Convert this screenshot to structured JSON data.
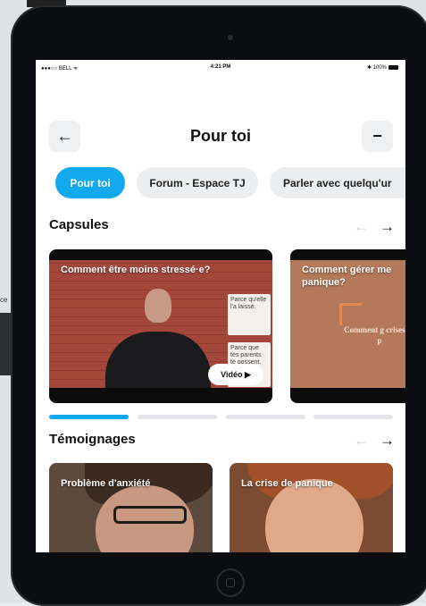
{
  "background": {
    "side_label": "ce"
  },
  "status_bar": {
    "carrier": "●●●○○ BELL ᯤ",
    "time": "4:21 PM",
    "battery": "✱ 100%"
  },
  "header": {
    "title": "Pour toi",
    "back_icon": "←",
    "minus_icon": "−"
  },
  "tabs": [
    {
      "label": "Pour toi",
      "active": true
    },
    {
      "label": "Forum - Espace TJ",
      "active": false
    },
    {
      "label": "Parler avec quelqu'ur",
      "active": false
    }
  ],
  "capsules": {
    "title": "Capsules",
    "prev_icon": "←",
    "next_icon": "→",
    "cards": [
      {
        "title": "Comment être moins stressé·e?",
        "button": "Vidéo ▶",
        "poster_top": "Parce qu'elle l'a laissé.",
        "poster_bottom": "Parce que tes parents te gossent."
      },
      {
        "title": "Comment gérer me panique?",
        "overlay": "Comment g crises de p"
      }
    ],
    "progress": {
      "active_index": 0,
      "count": 4
    }
  },
  "temoignages": {
    "title": "Témoignages",
    "prev_icon": "←",
    "next_icon": "→",
    "cards": [
      {
        "title": "Problème d'anxiété"
      },
      {
        "title": "La crise de panique"
      }
    ]
  },
  "colors": {
    "accent": "#12a9ee",
    "chip_bg": "#eceef0"
  }
}
